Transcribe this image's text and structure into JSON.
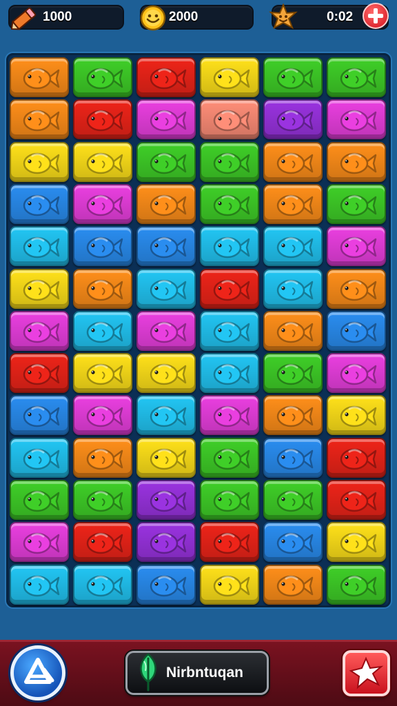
{
  "hud": {
    "pencil_count": "1000",
    "coin_count": "2000",
    "star_value": "0:02",
    "icons": {
      "pencil": "pencil-icon",
      "coin": "smiley-coin-icon",
      "star": "star-badge-icon",
      "add": "plus-icon"
    }
  },
  "board": {
    "rows": 13,
    "cols": 6,
    "fish_icon": "fish-icon",
    "palette": {
      "Y": "#ffe11a",
      "G": "#3fcf28",
      "R": "#ee2419",
      "O": "#ff8f1a",
      "P": "#ea3fe0",
      "B": "#2a8df0",
      "C": "#22c6f4",
      "S": "#ff8e78",
      "V": "#9a33e0"
    },
    "tiles": [
      [
        "O",
        "G",
        "R",
        "Y",
        "G",
        "G"
      ],
      [
        "O",
        "R",
        "P",
        "S",
        "V",
        "P"
      ],
      [
        "Y",
        "Y",
        "G",
        "G",
        "O",
        "O"
      ],
      [
        "B",
        "P",
        "O",
        "G",
        "O",
        "G"
      ],
      [
        "C",
        "B",
        "B",
        "C",
        "C",
        "P"
      ],
      [
        "Y",
        "O",
        "C",
        "R",
        "C",
        "O"
      ],
      [
        "P",
        "C",
        "P",
        "C",
        "O",
        "B"
      ],
      [
        "R",
        "Y",
        "Y",
        "C",
        "G",
        "P"
      ],
      [
        "B",
        "P",
        "C",
        "P",
        "O",
        "Y"
      ],
      [
        "C",
        "O",
        "Y",
        "G",
        "B",
        "R"
      ],
      [
        "G",
        "G",
        "V",
        "G",
        "G",
        "R"
      ],
      [
        "P",
        "R",
        "V",
        "R",
        "B",
        "Y"
      ],
      [
        "C",
        "C",
        "B",
        "Y",
        "O",
        "G"
      ]
    ]
  },
  "bottom": {
    "left_button_icon": "shuffle-icon",
    "center_button_label": "Nirbntuqan",
    "center_button_icon": "leaf-icon",
    "right_button_icon": "star-burst-icon"
  }
}
